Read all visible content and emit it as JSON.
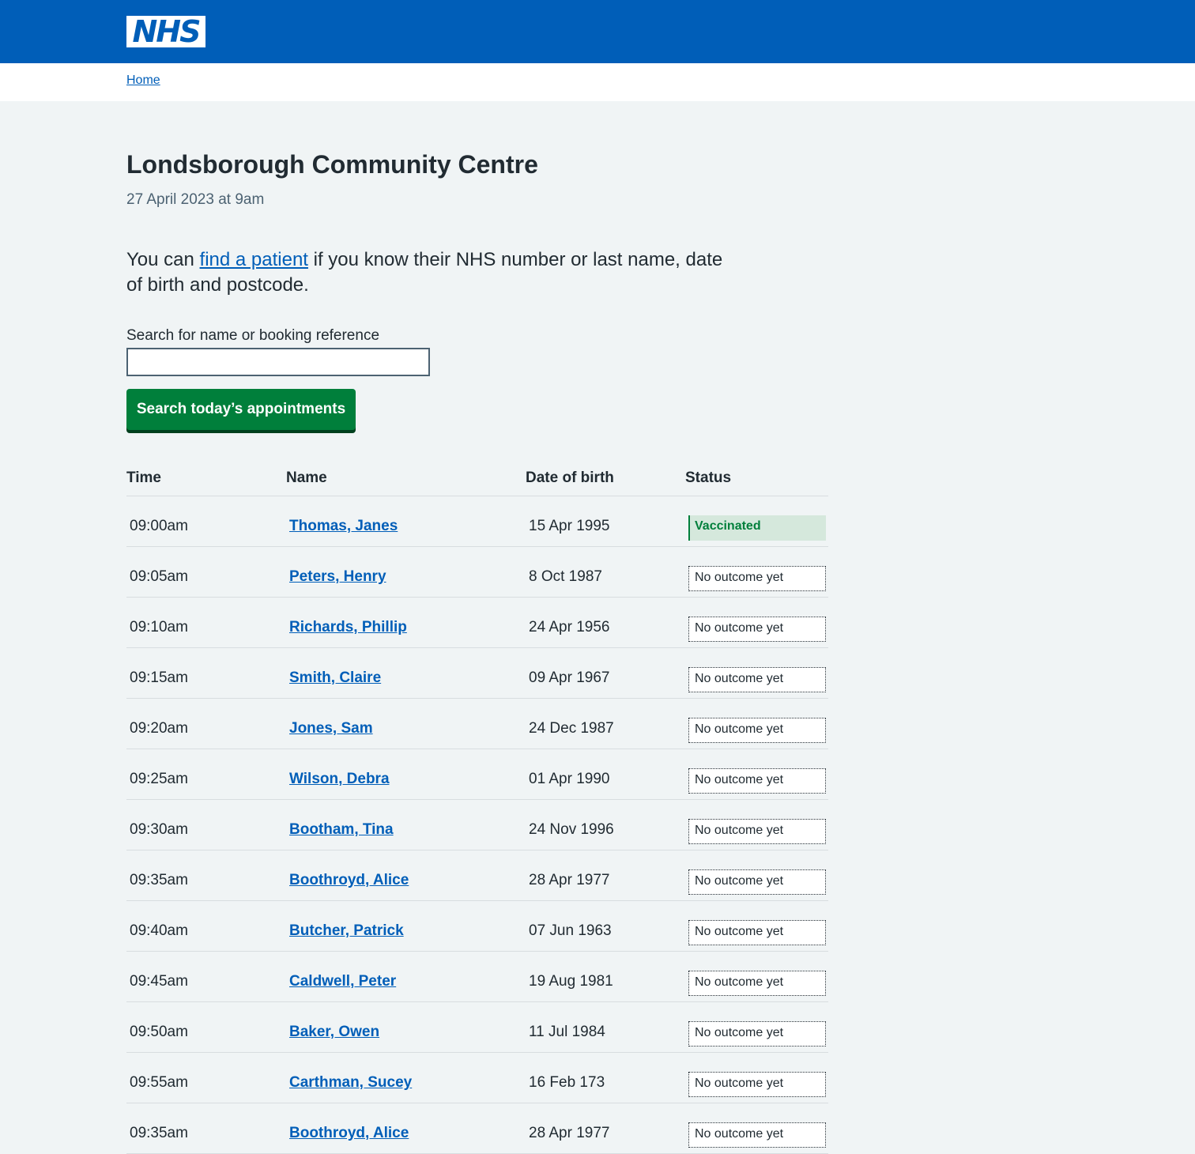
{
  "header": {
    "logo_text": "NHS"
  },
  "breadcrumb": {
    "home_label": "Home"
  },
  "page": {
    "title": "Londsborough Community Centre",
    "caption": "27 April 2023 at 9am",
    "lede_prefix": "You can ",
    "lede_link": "find a patient",
    "lede_suffix": " if you know their NHS number or last name, date of birth and postcode."
  },
  "search": {
    "label": "Search for name or booking reference",
    "value": "",
    "button_label": "Search today’s appointments"
  },
  "table": {
    "headers": {
      "time": "Time",
      "name": "Name",
      "dob": "Date of birth",
      "status": "Status"
    },
    "rows": [
      {
        "time": "09:00am",
        "name": "Thomas, Janes",
        "dob": "15 Apr 1995",
        "status": "Vaccinated",
        "status_type": "success"
      },
      {
        "time": "09:05am",
        "name": "Peters, Henry",
        "dob": "8 Oct 1987",
        "status": "No outcome yet",
        "status_type": "default"
      },
      {
        "time": "09:10am",
        "name": "Richards, Phillip",
        "dob": "24 Apr 1956",
        "status": "No outcome yet",
        "status_type": "default"
      },
      {
        "time": "09:15am",
        "name": "Smith, Claire",
        "dob": "09 Apr 1967",
        "status": "No outcome yet",
        "status_type": "default"
      },
      {
        "time": "09:20am",
        "name": "Jones, Sam",
        "dob": "24 Dec 1987",
        "status": "No outcome yet",
        "status_type": "default"
      },
      {
        "time": "09:25am",
        "name": "Wilson, Debra",
        "dob": "01 Apr 1990",
        "status": "No outcome yet",
        "status_type": "default"
      },
      {
        "time": "09:30am",
        "name": "Bootham, Tina",
        "dob": "24 Nov 1996",
        "status": "No outcome yet",
        "status_type": "default"
      },
      {
        "time": "09:35am",
        "name": "Boothroyd, Alice",
        "dob": "28 Apr 1977",
        "status": "No outcome yet",
        "status_type": "default"
      },
      {
        "time": "09:40am",
        "name": "Butcher, Patrick",
        "dob": "07 Jun 1963",
        "status": "No outcome yet",
        "status_type": "default"
      },
      {
        "time": "09:45am",
        "name": "Caldwell, Peter",
        "dob": "19 Aug 1981",
        "status": "No outcome yet",
        "status_type": "default"
      },
      {
        "time": "09:50am",
        "name": "Baker, Owen",
        "dob": "11 Jul 1984",
        "status": "No outcome yet",
        "status_type": "default"
      },
      {
        "time": "09:55am",
        "name": "Carthman, Sucey",
        "dob": "16 Feb 173",
        "status": "No outcome yet",
        "status_type": "default"
      },
      {
        "time": "09:35am",
        "name": "Boothroyd, Alice",
        "dob": "28 Apr 1977",
        "status": "No outcome yet",
        "status_type": "default"
      }
    ]
  },
  "colors": {
    "header_blue": "#005eb8",
    "button_green": "#007f3b",
    "link_blue": "#005eb8",
    "page_bg": "#f0f4f5"
  }
}
